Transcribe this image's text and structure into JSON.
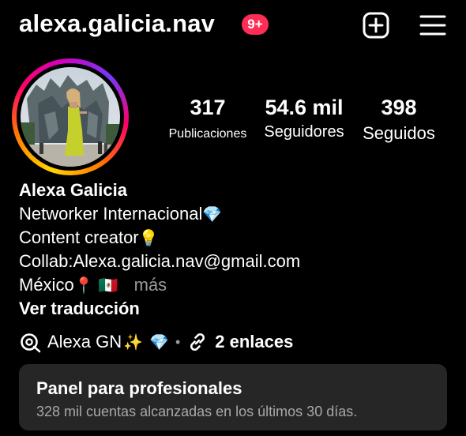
{
  "header": {
    "username": "alexa.galicia.nav",
    "notification_badge": "9+",
    "add_icon": "plus-square-icon",
    "menu_icon": "hamburger-menu-icon"
  },
  "stats": {
    "posts": {
      "value": "317",
      "label": "Publicaciones"
    },
    "followers": {
      "value": "54.6 mil",
      "label": "Seguidores"
    },
    "following": {
      "value": "398",
      "label": "Seguidos"
    }
  },
  "bio": {
    "name": "Alexa Galicia",
    "line1": "Networker Internacional",
    "line2": "Content creator",
    "line3": "Collab:Alexa.galicia.nav@gmail.com",
    "line4": "México",
    "more": "más",
    "translate": "Ver traducción",
    "emoji": {
      "diamond": "💎",
      "bulb": "💡",
      "pin": "📍",
      "flag": "🇲🇽"
    }
  },
  "links": {
    "threads_name": "Alexa GN",
    "sparkle": "✨",
    "diamond": "💎",
    "separator": "•",
    "links_count": "2 enlaces"
  },
  "dashboard": {
    "title": "Panel para profesionales",
    "subtitle": "328 mil cuentas alcanzadas en los últimos 30 días."
  },
  "colors": {
    "background": "#000000",
    "badge": "#ff2d55",
    "panel": "#262626",
    "muted_text": "#a8a8a8"
  }
}
